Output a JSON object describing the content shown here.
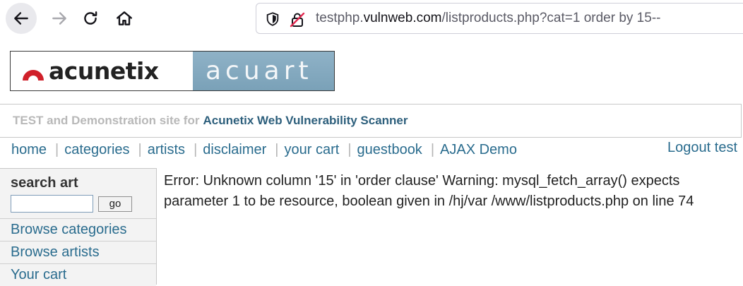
{
  "browser": {
    "url_prefix": "testphp.",
    "url_domain": "vulnweb.com",
    "url_suffix": "/listproducts.php?cat=1 order by 15--"
  },
  "logo": {
    "brand_left": "acunetix",
    "brand_right": "acuart"
  },
  "tagline": {
    "grey_part": "TEST and Demonstration site for",
    "blue_part": "Acunetix Web Vulnerability Scanner"
  },
  "menu": {
    "items": [
      "home",
      "categories",
      "artists",
      "disclaimer",
      "your cart",
      "guestbook",
      "AJAX Demo"
    ],
    "logout": "Logout test"
  },
  "sidebar": {
    "search_title": "search art",
    "search_value": "",
    "go_label": "go",
    "links": [
      "Browse categories",
      "Browse artists",
      "Your cart"
    ]
  },
  "main": {
    "error_message": "Error: Unknown column '15' in 'order clause' Warning: mysql_fetch_array() expects parameter 1 to be resource, boolean given in /hj/var /www/listproducts.php on line 74"
  },
  "colors": {
    "link": "#2a6c8e",
    "tagline_blue": "#2d5f7c",
    "logo_red": "#d0202a",
    "logo_blue": "#7aa1b8"
  }
}
